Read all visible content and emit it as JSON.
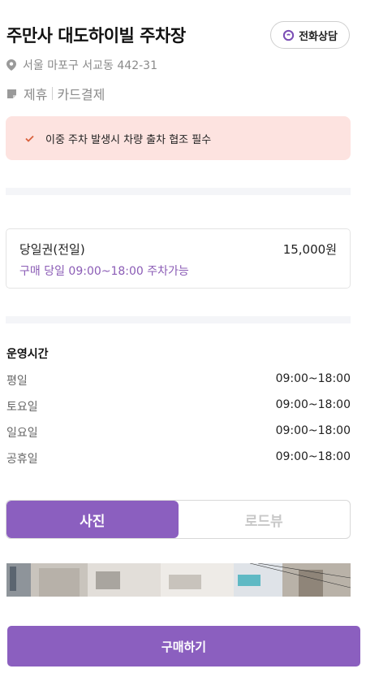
{
  "header": {
    "title": "주만사 대도하이빌 주차장",
    "call_label": "전화상담",
    "address": "서울 마포구 서교동 442-31",
    "tags": [
      "제휴",
      "카드결제"
    ]
  },
  "notice": {
    "text": "이중 주차 발생시 차량 출차 협조 필수"
  },
  "ticket": {
    "name": "당일권(전일)",
    "price": "15,000원",
    "desc": "구매 당일 09:00~18:00 주차가능"
  },
  "hours": {
    "title": "운영시간",
    "rows": [
      {
        "day": "평일",
        "time": "09:00~18:00"
      },
      {
        "day": "토요일",
        "time": "09:00~18:00"
      },
      {
        "day": "일요일",
        "time": "09:00~18:00"
      },
      {
        "day": "공휴일",
        "time": "09:00~18:00"
      }
    ]
  },
  "tabs": {
    "photo": "사진",
    "roadview": "로드뷰"
  },
  "footer": {
    "buy_label": "구매하기"
  },
  "colors": {
    "accent": "#8b5fbf",
    "notice_bg": "#fde3e0",
    "check": "#d9603c"
  }
}
